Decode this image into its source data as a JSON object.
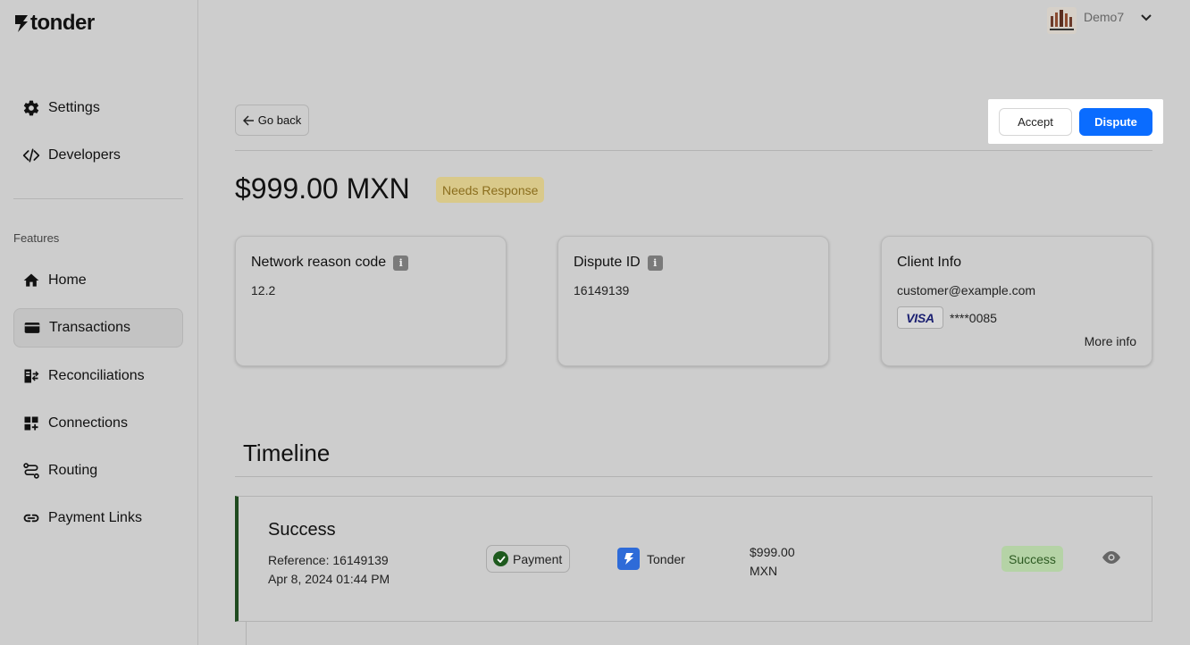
{
  "brand": {
    "name": "tonder"
  },
  "sidebar": {
    "top_items": [
      {
        "label": "Settings",
        "icon": "gear-icon"
      },
      {
        "label": "Developers",
        "icon": "code-icon"
      }
    ],
    "section_label": "Features",
    "items": [
      {
        "label": "Home",
        "icon": "home-icon"
      },
      {
        "label": "Transactions",
        "icon": "card-icon",
        "active": true
      },
      {
        "label": "Reconciliations",
        "icon": "reconcile-icon"
      },
      {
        "label": "Connections",
        "icon": "connections-icon"
      },
      {
        "label": "Routing",
        "icon": "routing-icon"
      },
      {
        "label": "Payment Links",
        "icon": "link-icon"
      }
    ]
  },
  "header": {
    "user_name": "Demo7"
  },
  "toolbar": {
    "back_label": "Go back",
    "accept_label": "Accept",
    "dispute_label": "Dispute"
  },
  "dispute": {
    "amount": "$999.00 MXN",
    "status": "Needs Response",
    "cards": {
      "reason": {
        "title": "Network reason code",
        "value": "12.2"
      },
      "dispute_id": {
        "title": "Dispute ID",
        "value": "16149139"
      },
      "client": {
        "title": "Client Info",
        "email": "customer@example.com",
        "card_brand": "VISA",
        "card_number": "****0085",
        "more_label": "More info"
      }
    }
  },
  "timeline": {
    "title": "Timeline",
    "event": {
      "title": "Success",
      "reference": "Reference: 16149139",
      "date": "Apr 8, 2024 01:44 PM",
      "type": "Payment",
      "provider": "Tonder",
      "amount_line1": "$999.00",
      "amount_line2": "MXN",
      "status": "Success"
    }
  },
  "colors": {
    "accent": "#0a6cff",
    "warning_bg": "#d9c98a",
    "success_bg": "#b5d3a6"
  }
}
